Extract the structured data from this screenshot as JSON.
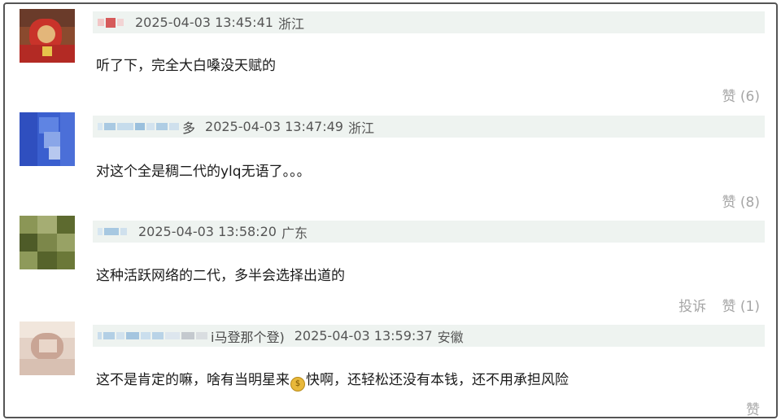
{
  "comments": [
    {
      "name_suffix": "",
      "timestamp": "2025-04-03 13:45:41",
      "location": "浙江",
      "text": "听了下，完全大白嗓没天赋的",
      "like_label": "赞 (6)",
      "report_label": ""
    },
    {
      "name_suffix": "多",
      "timestamp": "2025-04-03 13:47:49",
      "location": "浙江",
      "text": "对这个全是稠二代的ylq无语了。。。",
      "like_label": "赞 (8)",
      "report_label": ""
    },
    {
      "name_suffix": "",
      "timestamp": "2025-04-03 13:58:20",
      "location": "广东",
      "text": "这种活跃网络的二代，多半会选择出道的",
      "like_label": "赞 (1)",
      "report_label": "投诉"
    },
    {
      "name_suffix": "i马登那个登)",
      "timestamp": "2025-04-03 13:59:37",
      "location": "安徽",
      "text_before": "这不是肯定的嘛，啥有当明星来",
      "text_emoji": "money-bag-emoji",
      "text_after": "快啊，还轻松还没有本钱，还不用承担风险",
      "like_label": "赞",
      "report_label": ""
    }
  ],
  "colors": {
    "meta_bar_bg": "#eef3f0",
    "action_text": "#a6a6a6",
    "frame_border": "#555555"
  }
}
